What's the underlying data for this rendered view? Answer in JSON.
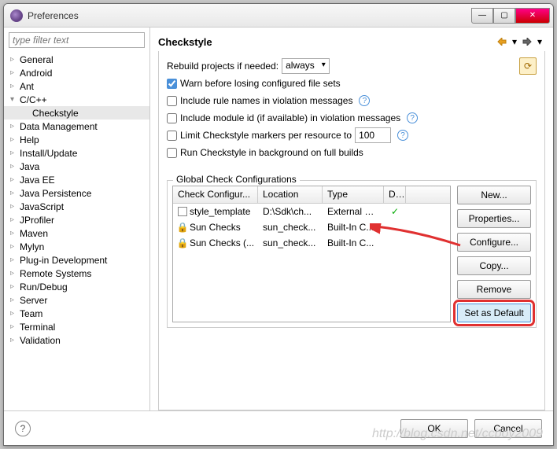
{
  "window": {
    "title": "Preferences"
  },
  "filter": {
    "placeholder": "type filter text"
  },
  "tree": [
    {
      "label": "General"
    },
    {
      "label": "Android"
    },
    {
      "label": "Ant"
    },
    {
      "label": "C/C++",
      "expanded": true,
      "children": [
        {
          "label": "Checkstyle"
        }
      ]
    },
    {
      "label": "Data Management"
    },
    {
      "label": "Help"
    },
    {
      "label": "Install/Update"
    },
    {
      "label": "Java"
    },
    {
      "label": "Java EE"
    },
    {
      "label": "Java Persistence"
    },
    {
      "label": "JavaScript"
    },
    {
      "label": "JProfiler"
    },
    {
      "label": "Maven"
    },
    {
      "label": "Mylyn"
    },
    {
      "label": "Plug-in Development"
    },
    {
      "label": "Remote Systems"
    },
    {
      "label": "Run/Debug"
    },
    {
      "label": "Server"
    },
    {
      "label": "Team"
    },
    {
      "label": "Terminal"
    },
    {
      "label": "Validation"
    }
  ],
  "page": {
    "heading": "Checkstyle",
    "rebuild_label": "Rebuild projects if needed:",
    "rebuild_value": "always",
    "warn_label": "Warn before losing configured file sets",
    "include_rule_label": "Include rule names in violation messages",
    "include_module_label": "Include module id (if available) in violation messages",
    "limit_label": "Limit Checkstyle markers per resource to",
    "limit_value": "100",
    "bg_label": "Run Checkstyle in background on full builds",
    "group_label": "Global Check Configurations",
    "columns": {
      "c1": "Check Configur...",
      "c2": "Location",
      "c3": "Type",
      "c4": "D..."
    },
    "rows": [
      {
        "icon": "doc",
        "name": "style_template",
        "location": "D:\\Sdk\\ch...",
        "type": "External C...",
        "default": "✓"
      },
      {
        "icon": "lock",
        "name": "Sun Checks",
        "location": "sun_check...",
        "type": "Built-In C...",
        "default": ""
      },
      {
        "icon": "lock",
        "name": "Sun Checks (...",
        "location": "sun_check...",
        "type": "Built-In C...",
        "default": ""
      }
    ],
    "buttons": {
      "new": "New...",
      "properties": "Properties...",
      "configure": "Configure...",
      "copy": "Copy...",
      "remove": "Remove",
      "set_default": "Set as Default"
    }
  },
  "footer": {
    "ok": "OK",
    "cancel": "Cancel"
  },
  "watermark": "http://blog.csdn.net/ccboy2009"
}
